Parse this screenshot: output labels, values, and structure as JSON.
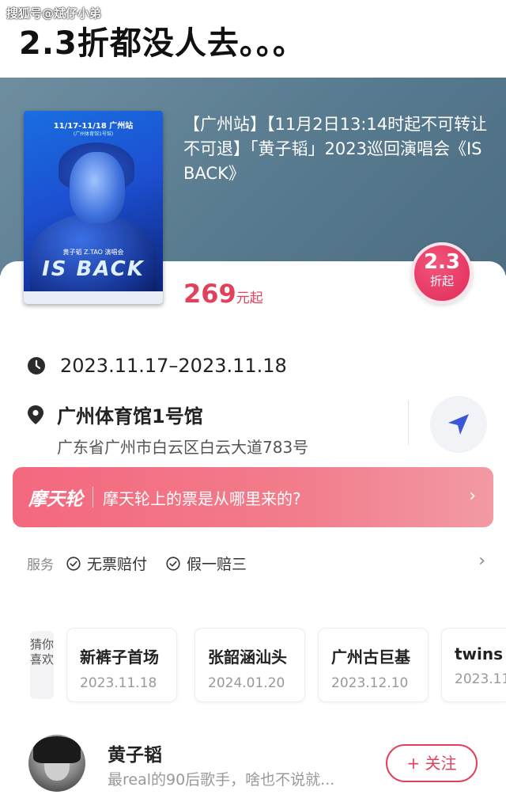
{
  "watermark": "搜狐号@斌仔小弟",
  "headline": "2.3折都没人去。。。",
  "poster": {
    "top_text": "11/17-11/18 广州站",
    "sub_text": "(广州体育馆1号馆)",
    "caption": "黄子韬 Z.TAO 演唱会",
    "title": "IS BACK"
  },
  "event": {
    "title": "【广州站】【11月2日13:14时起不可转让不可退】「黄子韬」2023巡回演唱会《IS BACK》",
    "price_value": "269",
    "price_unit": "元起",
    "discount_value": "2.3",
    "discount_label": "折起",
    "date_range": "2023.11.17–2023.11.18",
    "venue_name": "广州体育馆1号馆",
    "venue_address": "广东省广州市白云区白云大道783号"
  },
  "ferris": {
    "logo": "摩天轮",
    "text": "摩天轮上的票是从哪里来的?"
  },
  "service": {
    "label": "服务",
    "items": [
      "无票赔付",
      "假一赔三"
    ]
  },
  "recommend": {
    "tag": "猜你喜欢",
    "items": [
      {
        "name": "新裤子首场",
        "date": "2023.11.18"
      },
      {
        "name": "张韶涵汕头",
        "date": "2024.01.20"
      },
      {
        "name": "广州古巨基",
        "date": "2023.12.10"
      },
      {
        "name": "twins",
        "date": "2023.11"
      }
    ]
  },
  "artist": {
    "name": "黄子韬",
    "bio": "最real的90后歌手，啥也不说就...",
    "follow_label": "+ 关注"
  },
  "colors": {
    "accent": "#e2415c",
    "banner": "#f4687e",
    "hero_bg": "#587a8e"
  }
}
